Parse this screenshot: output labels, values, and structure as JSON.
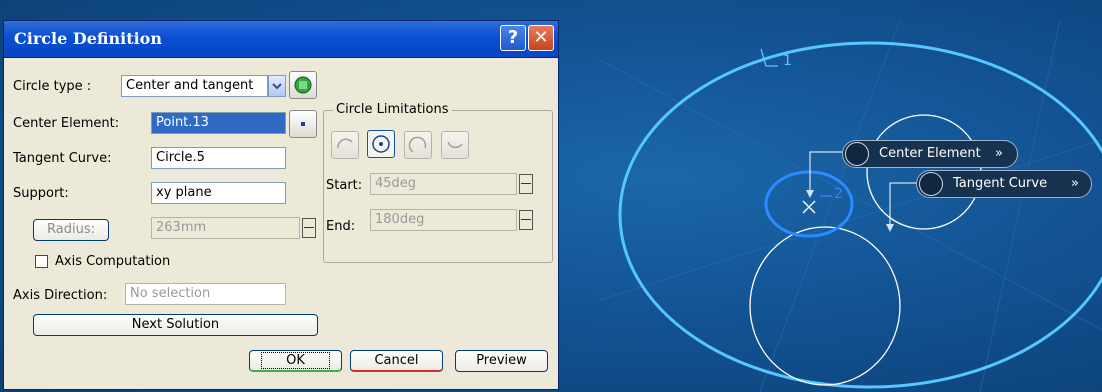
{
  "dialog": {
    "title": "Circle Definition",
    "help_icon": "?",
    "close_icon": "✕",
    "circle_type_label": "Circle type :",
    "circle_type_value": "Center and tangent",
    "center_element_label": "Center Element:",
    "center_element_value": "Point.13",
    "tangent_curve_label": "Tangent Curve:",
    "tangent_curve_value": "Circle.5",
    "support_label": "Support:",
    "support_value": "xy plane",
    "radius_label": "Radius:",
    "radius_value": "263mm",
    "limitations_title": "Circle Limitations",
    "start_label": "Start:",
    "start_value": "45deg",
    "end_label": "End:",
    "end_value": "180deg",
    "axis_computation_label": "Axis Computation",
    "axis_direction_label": "Axis Direction:",
    "axis_direction_value": "No selection",
    "next_solution_label": "Next Solution",
    "ok_label": "OK",
    "cancel_label": "Cancel",
    "preview_label": "Preview"
  },
  "viewport": {
    "label_1": "1",
    "label_2": "2",
    "callout_center": "Center Element",
    "callout_tangent": "Tangent Curve",
    "callout_arrow": "»"
  },
  "colors": {
    "titlebar": "#0a4fd2",
    "dialog_bg": "#ece9d8",
    "viewport_bg": "#135394",
    "highlight_circle": "#4fc3ff"
  }
}
